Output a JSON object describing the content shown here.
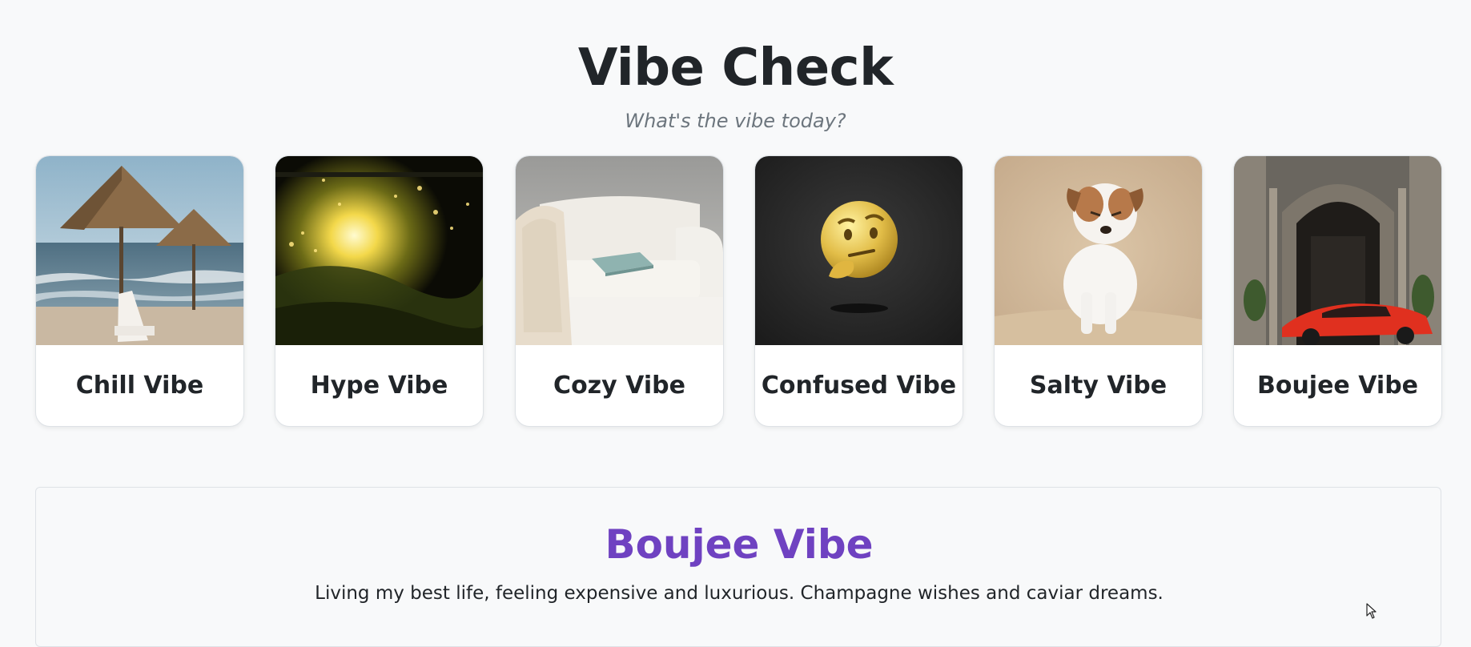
{
  "header": {
    "title": "Vibe Check",
    "subtitle": "What's the vibe today?"
  },
  "cards": [
    {
      "label": "Chill Vibe",
      "image": "beach-umbrellas-image"
    },
    {
      "label": "Hype Vibe",
      "image": "concert-crowd-image"
    },
    {
      "label": "Cozy Vibe",
      "image": "white-armchair-image"
    },
    {
      "label": "Confused Vibe",
      "image": "thinking-face-emoji-image"
    },
    {
      "label": "Salty Vibe",
      "image": "grumpy-puppy-image"
    },
    {
      "label": "Boujee Vibe",
      "image": "luxury-hotel-sports-car-image"
    }
  ],
  "selected": {
    "title": "Boujee Vibe",
    "description": "Living my best life, feeling expensive and luxurious. Champagne wishes and caviar dreams."
  },
  "colors": {
    "accent": "#6f42c1",
    "background": "#f8f9fa",
    "text": "#212529",
    "muted": "#6c757d"
  }
}
